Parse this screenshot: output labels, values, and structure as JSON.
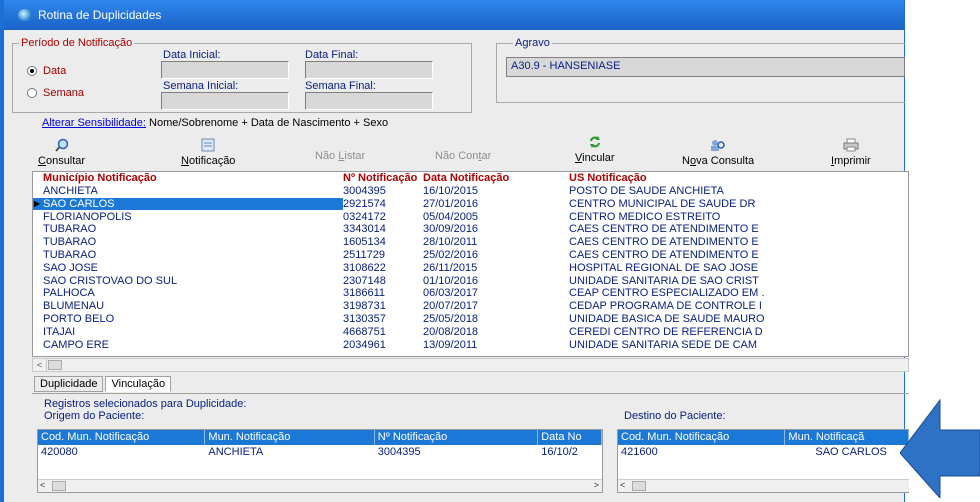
{
  "window": {
    "title": "Rotina de Duplicidades"
  },
  "periodo": {
    "label": "Período de Notificação",
    "radio_data": "Data",
    "radio_semana": "Semana",
    "data_inicial": "Data Inicial:",
    "data_final": "Data Final:",
    "semana_inicial": "Semana Inicial:",
    "semana_final": "Semana Final:"
  },
  "agravo": {
    "label": "Agravo",
    "value": "A30.9 - HANSENIASE"
  },
  "sensibilidade": {
    "link": "Alterar Sensibilidade:",
    "value": "Nome/Sobrenome + Data de Nascimento + Sexo"
  },
  "toolbar": {
    "consultar": {
      "pre": "",
      "u": "C",
      "post": "onsultar"
    },
    "notificacao": {
      "pre": "",
      "u": "N",
      "post": "otificação"
    },
    "nao_listar": {
      "pre": "Não ",
      "u": "L",
      "post": "istar"
    },
    "nao_contar": {
      "pre": "Não Con",
      "u": "t",
      "post": "ar"
    },
    "vincular": {
      "pre": "",
      "u": "V",
      "post": "incular"
    },
    "nova_consulta": {
      "pre": "N",
      "u": "o",
      "post": "va Consulta"
    },
    "imprimir": {
      "pre": "",
      "u": "I",
      "post": "mprimir"
    }
  },
  "grid": {
    "headers": [
      "Município Notificação",
      "Nº Notificação",
      "Data Notificação",
      "US Notificação"
    ],
    "rows": [
      [
        "ANCHIETA",
        "3004395",
        "16/10/2015",
        "POSTO DE SAUDE ANCHIETA"
      ],
      [
        "SAO CARLOS",
        "2921574",
        "27/01/2016",
        "CENTRO MUNICIPAL DE SAUDE DR"
      ],
      [
        "FLORIANOPOLIS",
        "0324172",
        "05/04/2005",
        "CENTRO MEDICO ESTREITO"
      ],
      [
        "TUBARAO",
        "3343014",
        "30/09/2016",
        "CAES CENTRO DE ATENDIMENTO E"
      ],
      [
        "TUBARAO",
        "1605134",
        "28/10/2011",
        "CAES CENTRO DE ATENDIMENTO E"
      ],
      [
        "TUBARAO",
        "2511729",
        "25/02/2016",
        "CAES CENTRO DE ATENDIMENTO E"
      ],
      [
        "SAO JOSE",
        "3108622",
        "26/11/2015",
        "HOSPITAL REGIONAL DE SAO JOSE"
      ],
      [
        "SAO CRISTOVAO DO SUL",
        "2307148",
        "01/10/2016",
        "UNIDADE SANITARIA DE SAO CRIST"
      ],
      [
        "PALHOCA",
        "3186611",
        "06/03/2017",
        "CEAP CENTRO ESPECIALIZADO EM ."
      ],
      [
        "BLUMENAU",
        "3198731",
        "20/07/2017",
        "CEDAP PROGRAMA DE CONTROLE I"
      ],
      [
        "PORTO BELO",
        "3130357",
        "25/05/2018",
        "UNIDADE BASICA DE SAUDE MAURO"
      ],
      [
        "ITAJAI",
        "4668751",
        "20/08/2018",
        "CEREDI CENTRO DE REFERENCIA D"
      ],
      [
        "CAMPO ERE",
        "2034961",
        "13/09/2011",
        "UNIDADE SANITARIA SEDE DE CAM"
      ]
    ],
    "selected_index": 1
  },
  "tabs": [
    "Duplicidade",
    "Vinculação"
  ],
  "panel": {
    "title": "Registros selecionados para Duplicidade:",
    "origem_label": "Origem do Paciente:",
    "destino_label": "Destino do Paciente:",
    "origem_headers": [
      "Cod. Mun. Notificação",
      "Mun. Notificação",
      "Nº Notificação",
      "Data No"
    ],
    "origem_row": [
      "420080",
      "ANCHIETA",
      "3004395",
      "16/10/2"
    ],
    "destino_headers": [
      "Cod. Mun. Notificação",
      "Mun. Notificaçã"
    ],
    "destino_row": [
      "421600",
      "SAO CARLOS"
    ]
  },
  "colors": {
    "title_bar": "#1a63c9",
    "selection": "#1c78d6",
    "label_red": "#b00000",
    "text_blue": "#0a2080",
    "arrow": "#2d72c4"
  }
}
